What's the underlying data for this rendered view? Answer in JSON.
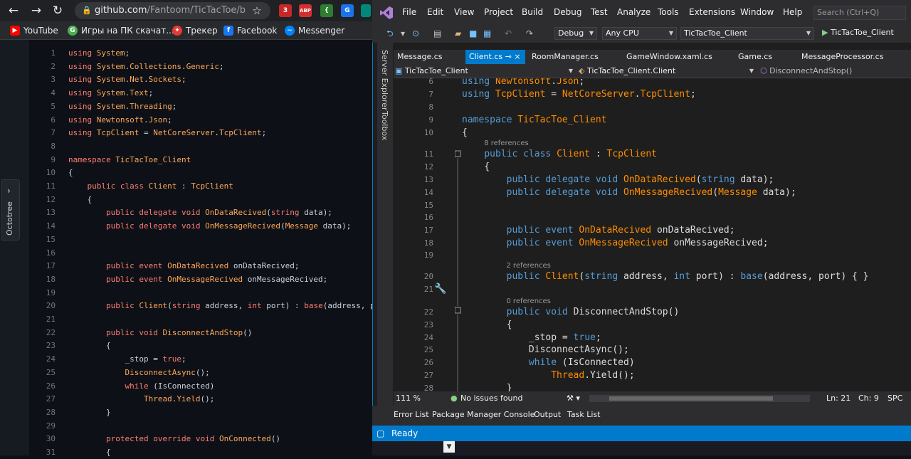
{
  "browser": {
    "url_host": "github.com",
    "url_path": "/Fantoom/TicTacToe/b",
    "bookmarks": [
      {
        "label": "YouTube",
        "icon": "youtube-icon",
        "color": "#ff0000"
      },
      {
        "label": "Игры на ПК скачат...",
        "icon": "game-site-icon",
        "color": "#4caf50"
      },
      {
        "label": "Трекер",
        "icon": "tracker-icon",
        "color": "#e53935"
      },
      {
        "label": "Facebook",
        "icon": "facebook-icon",
        "color": "#1877f2"
      },
      {
        "label": "Messenger",
        "icon": "messenger-icon",
        "color": "#0084ff"
      }
    ],
    "ext_badge": "3",
    "ext_abp": "ABP"
  },
  "github": {
    "sidebar_label": "Octotree",
    "lines": [
      {
        "n": "1",
        "t": "using System;"
      },
      {
        "n": "2",
        "t": "using System.Collections.Generic;"
      },
      {
        "n": "3",
        "t": "using System.Net.Sockets;"
      },
      {
        "n": "4",
        "t": "using System.Text;"
      },
      {
        "n": "5",
        "t": "using System.Threading;"
      },
      {
        "n": "6",
        "t": "using Newtonsoft.Json;"
      },
      {
        "n": "7",
        "t": "using TcpClient = NetCoreServer.TcpClient;"
      },
      {
        "n": "8",
        "t": ""
      },
      {
        "n": "9",
        "t": "namespace TicTacToe_Client"
      },
      {
        "n": "10",
        "t": "{"
      },
      {
        "n": "11",
        "t": "    public class Client : TcpClient"
      },
      {
        "n": "12",
        "t": "    {"
      },
      {
        "n": "13",
        "t": "        public delegate void OnDataRecived(string data);"
      },
      {
        "n": "14",
        "t": "        public delegate void OnMessageRecived(Message data);"
      },
      {
        "n": "15",
        "t": ""
      },
      {
        "n": "16",
        "t": ""
      },
      {
        "n": "17",
        "t": "        public event OnDataRecived onDataRecived;"
      },
      {
        "n": "18",
        "t": "        public event OnMessageRecived onMessageRecived;"
      },
      {
        "n": "19",
        "t": ""
      },
      {
        "n": "20",
        "t": "        public Client(string address, int port) : base(address, port)"
      },
      {
        "n": "21",
        "t": ""
      },
      {
        "n": "22",
        "t": "        public void DisconnectAndStop()"
      },
      {
        "n": "23",
        "t": "        {"
      },
      {
        "n": "24",
        "t": "            _stop = true;"
      },
      {
        "n": "25",
        "t": "            DisconnectAsync();"
      },
      {
        "n": "26",
        "t": "            while (IsConnected)"
      },
      {
        "n": "27",
        "t": "                Thread.Yield();"
      },
      {
        "n": "28",
        "t": "        }"
      },
      {
        "n": "29",
        "t": ""
      },
      {
        "n": "30",
        "t": "        protected override void OnConnected()"
      },
      {
        "n": "31",
        "t": "        {"
      }
    ]
  },
  "vs": {
    "menu": [
      "File",
      "Edit",
      "View",
      "Project",
      "Build",
      "Debug",
      "Test",
      "Analyze",
      "Tools",
      "Extensions",
      "Window",
      "Help"
    ],
    "search_placeholder": "Search (Ctrl+Q)",
    "config": "Debug",
    "platform": "Any CPU",
    "startup_project": "TicTacToe_Client",
    "run_target": "TicTacToe_Client",
    "side_tabs": [
      "Server Explorer",
      "Toolbox"
    ],
    "doc_tabs": [
      {
        "label": "Message.cs",
        "active": false
      },
      {
        "label": "Client.cs",
        "active": true
      },
      {
        "label": "RoomManager.cs",
        "active": false
      },
      {
        "label": "GameWindow.xaml.cs",
        "active": false
      },
      {
        "label": "Game.cs",
        "active": false
      },
      {
        "label": "MessageProcessor.cs",
        "active": false
      }
    ],
    "pin_glyph": "⊸",
    "close_glyph": "×",
    "nav": {
      "project": "TicTacToe_Client",
      "type": "TicTacToe_Client.Client",
      "member": "DisconnectAndStop()"
    },
    "code": [
      {
        "n": "6",
        "t": "using Newtonsoft.Json;"
      },
      {
        "n": "7",
        "t": "using TcpClient = NetCoreServer.TcpClient;"
      },
      {
        "n": "8",
        "t": ""
      },
      {
        "n": "9",
        "t": "namespace TicTacToe_Client"
      },
      {
        "n": "10",
        "t": "{"
      },
      {
        "n": "11",
        "t": "    public class Client : TcpClient"
      },
      {
        "n": "12",
        "t": "    {"
      },
      {
        "n": "13",
        "t": "        public delegate void OnDataRecived(string data);"
      },
      {
        "n": "14",
        "t": "        public delegate void OnMessageRecived(Message data);"
      },
      {
        "n": "15",
        "t": ""
      },
      {
        "n": "16",
        "t": ""
      },
      {
        "n": "17",
        "t": "        public event OnDataRecived onDataRecived;"
      },
      {
        "n": "18",
        "t": "        public event OnMessageRecived onMessageRecived;"
      },
      {
        "n": "19",
        "t": ""
      },
      {
        "n": "20",
        "t": "        public Client(string address, int port) : base(address, port) { }"
      },
      {
        "n": "21",
        "t": ""
      },
      {
        "n": "22",
        "t": "        public void DisconnectAndStop()"
      },
      {
        "n": "23",
        "t": "        {"
      },
      {
        "n": "24",
        "t": "            _stop = true;"
      },
      {
        "n": "25",
        "t": "            DisconnectAsync();"
      },
      {
        "n": "26",
        "t": "            while (IsConnected)"
      },
      {
        "n": "27",
        "t": "                Thread.Yield();"
      },
      {
        "n": "28",
        "t": "        }"
      }
    ],
    "refs": {
      "class": "8 references",
      "ctor": "2 references",
      "method": "0 references"
    },
    "zoom": "111 %",
    "issues": "No issues found",
    "line": "Ln: 21",
    "col": "Ch: 9",
    "mode": "SPC",
    "bottom_tabs": [
      "Error List",
      "Package Manager Console",
      "Output",
      "Task List"
    ],
    "status": "Ready"
  }
}
